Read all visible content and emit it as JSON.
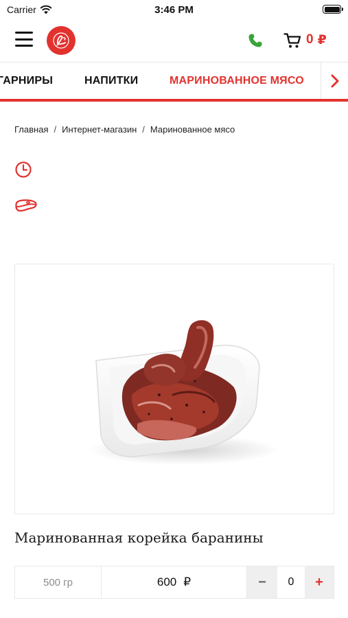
{
  "status_bar": {
    "carrier": "Carrier",
    "time": "3:46 PM"
  },
  "header": {
    "cart_total": "0",
    "currency": "₽",
    "icons": [
      "menu-icon",
      "logo",
      "phone-icon",
      "cart-icon"
    ],
    "colors": {
      "accent": "#e2322f",
      "phone": "#3aa33a"
    }
  },
  "categories": {
    "items": [
      {
        "label": "ГАРНИРЫ",
        "active": false
      },
      {
        "label": "НАПИТКИ",
        "active": false
      },
      {
        "label": "МАРИНОВАННОЕ МЯСО",
        "active": true
      }
    ]
  },
  "breadcrumb": {
    "separator": "/",
    "items": [
      "Главная",
      "Интернет-магазин",
      "Маринованное мясо"
    ]
  },
  "info_icons": [
    "clock-icon",
    "steak-icon"
  ],
  "product": {
    "title": "Маринованная корейка баранины",
    "weight": "500 гр",
    "price": "600",
    "currency": "₽",
    "quantity": "0",
    "minus_label": "−",
    "plus_label": "+"
  }
}
